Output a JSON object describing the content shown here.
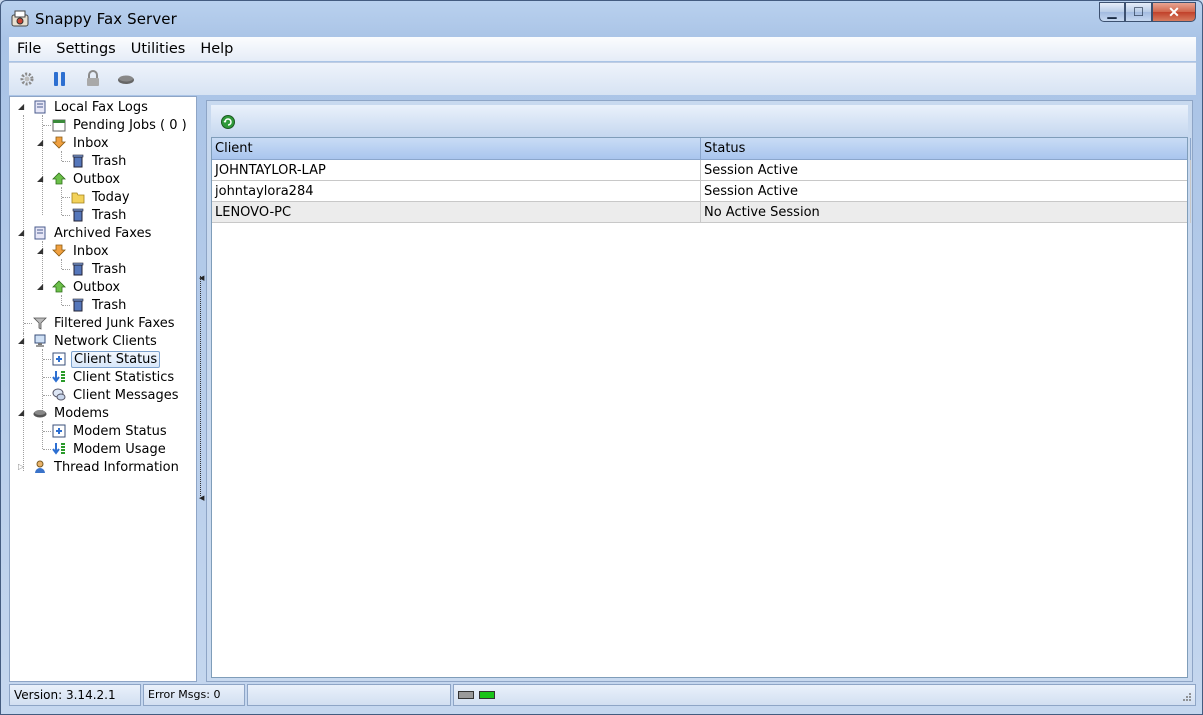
{
  "window": {
    "title": "Snappy Fax Server"
  },
  "menu": [
    "File",
    "Settings",
    "Utilities",
    "Help"
  ],
  "toolbar": [
    {
      "icon": "gear-icon"
    },
    {
      "icon": "pause-icon"
    },
    {
      "icon": "lock-icon"
    },
    {
      "icon": "modem-icon"
    }
  ],
  "tree": {
    "local_fax_logs": "Local Fax Logs",
    "pending_jobs": "Pending Jobs ( 0 )",
    "inbox": "Inbox",
    "trash": "Trash",
    "outbox": "Outbox",
    "today": "Today",
    "archived_faxes": "Archived Faxes",
    "filtered_junk": "Filtered Junk Faxes",
    "network_clients": "Network Clients",
    "client_status": "Client Status",
    "client_statistics": "Client Statistics",
    "client_messages": "Client Messages",
    "modems": "Modems",
    "modem_status": "Modem  Status",
    "modem_usage": "Modem  Usage",
    "thread_info": "Thread Information"
  },
  "grid": {
    "columns": [
      "Client",
      "Status"
    ],
    "rows": [
      [
        "JOHNTAYLOR-LAP",
        "Session Active"
      ],
      [
        "johntaylora284",
        "Session Active"
      ],
      [
        "LENOVO-PC",
        "No Active Session"
      ]
    ]
  },
  "status": {
    "version": "Version: 3.14.2.1",
    "error_msgs": "Error Msgs: 0"
  },
  "colors": {
    "led_idle": "#9a9a9a",
    "led_active": "#19c419"
  }
}
